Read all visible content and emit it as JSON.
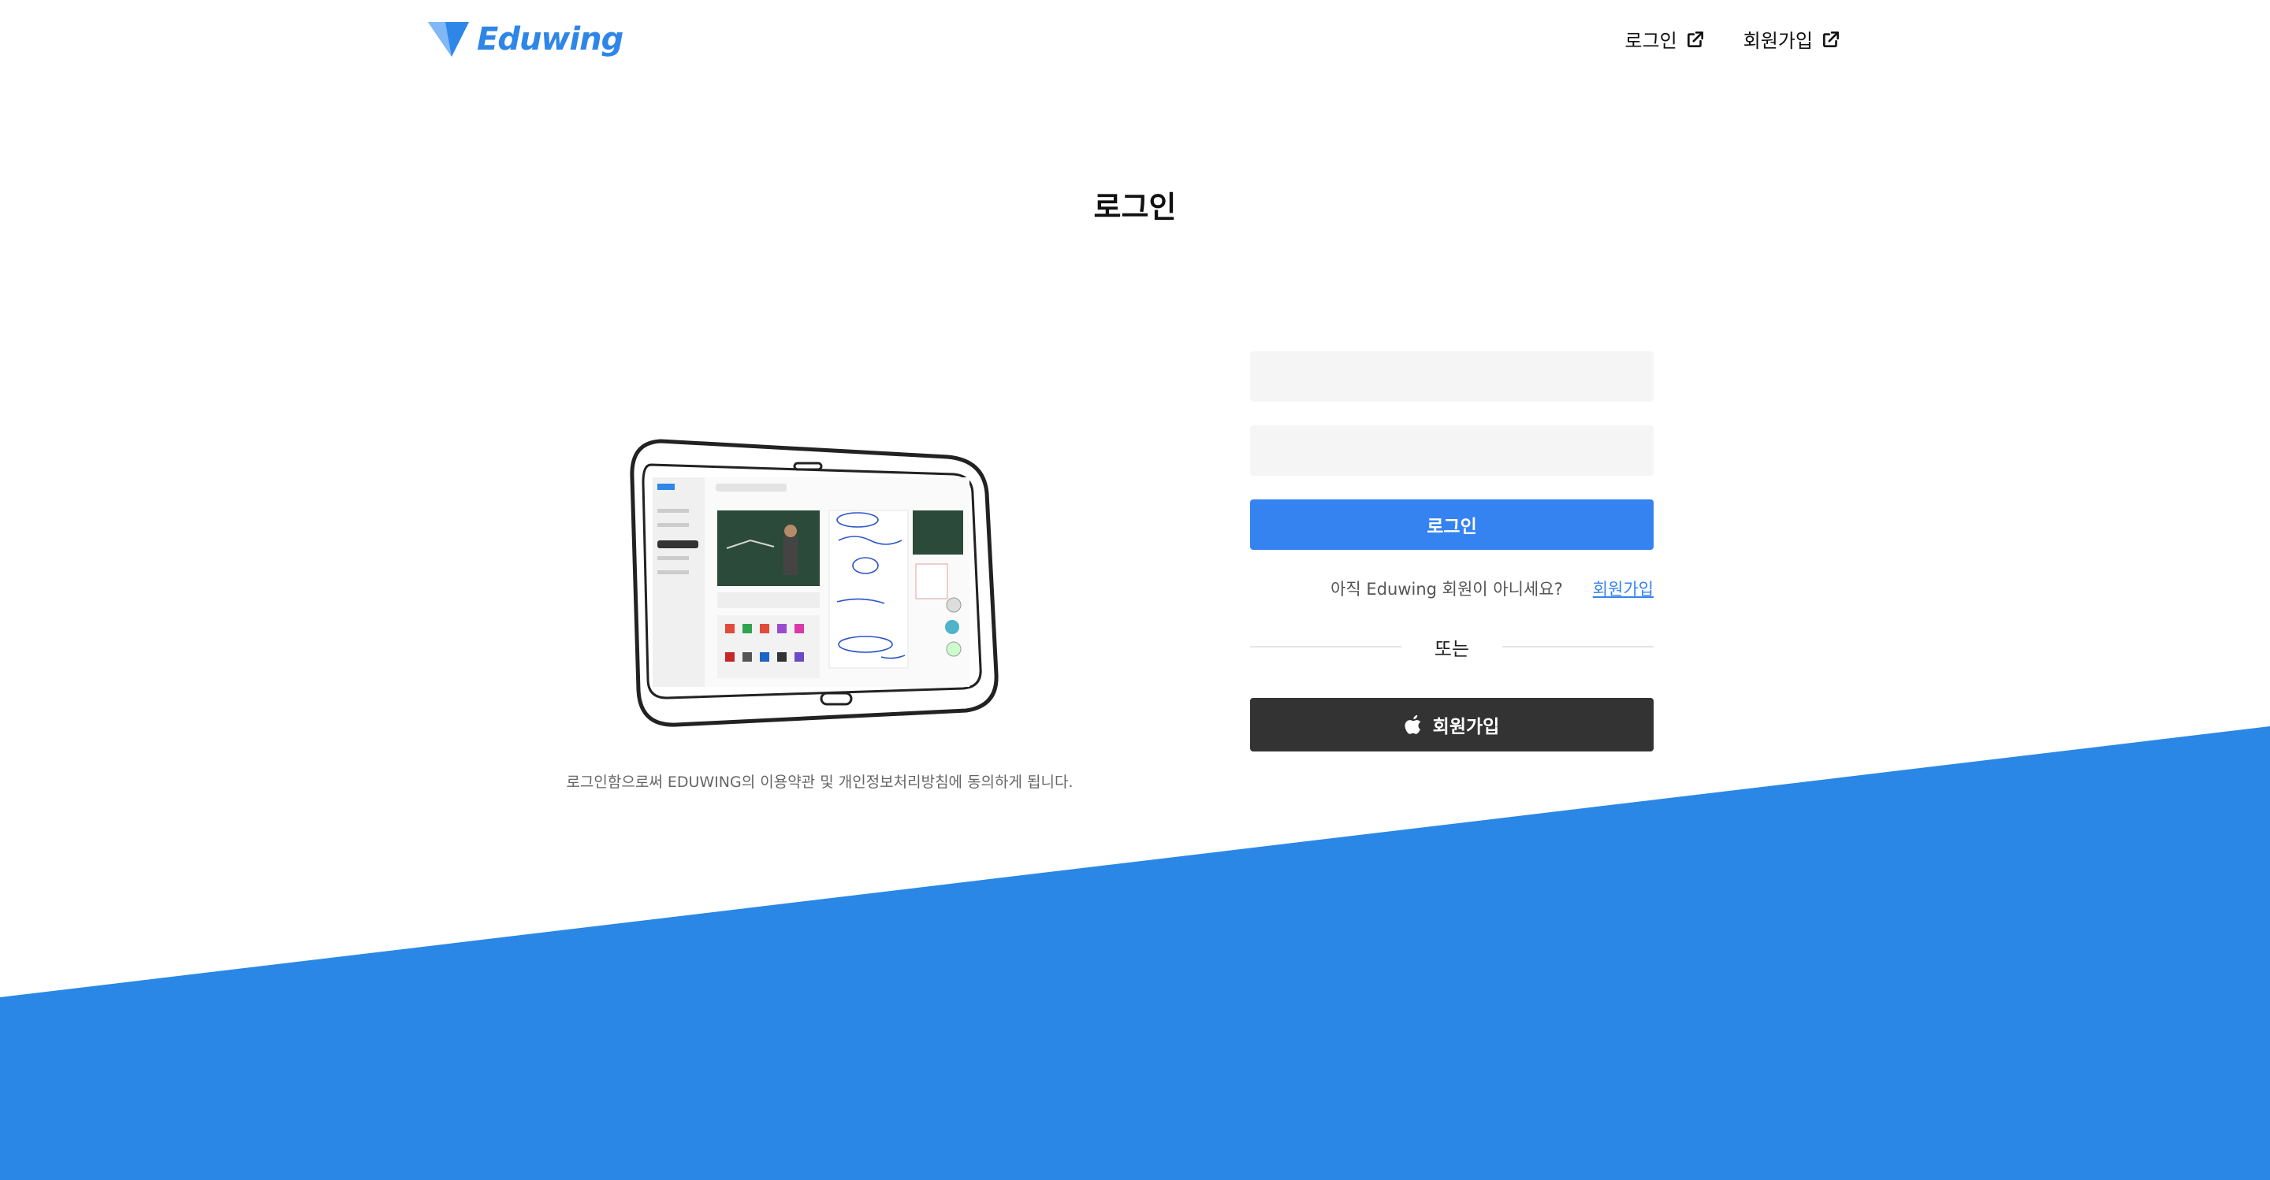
{
  "header": {
    "logo_text": "Eduwing",
    "nav": [
      {
        "label": "로그인",
        "icon": "external-link-icon"
      },
      {
        "label": "회원가입",
        "icon": "external-link-icon"
      }
    ]
  },
  "main": {
    "title": "로그인",
    "terms_text": "로그인함으로써 EDUWING의 이용약관 및 개인정보처리방침에 동의하게 됩니다."
  },
  "form": {
    "id_value": "",
    "id_placeholder": "",
    "password_value": "",
    "password_placeholder": "",
    "login_button": "로그인",
    "no_account_text": "아직 Eduwing 회원이 아니세요?",
    "signup_link": "회원가입",
    "divider_text": "또는",
    "apple_button": "회원가입",
    "apple_icon": "apple-icon"
  },
  "colors": {
    "brand": "#2e86e8",
    "primary_button": "#3483f0",
    "dark_button": "#333333",
    "background_wave": "#2a87e5",
    "input_bg": "#f5f5f5"
  }
}
